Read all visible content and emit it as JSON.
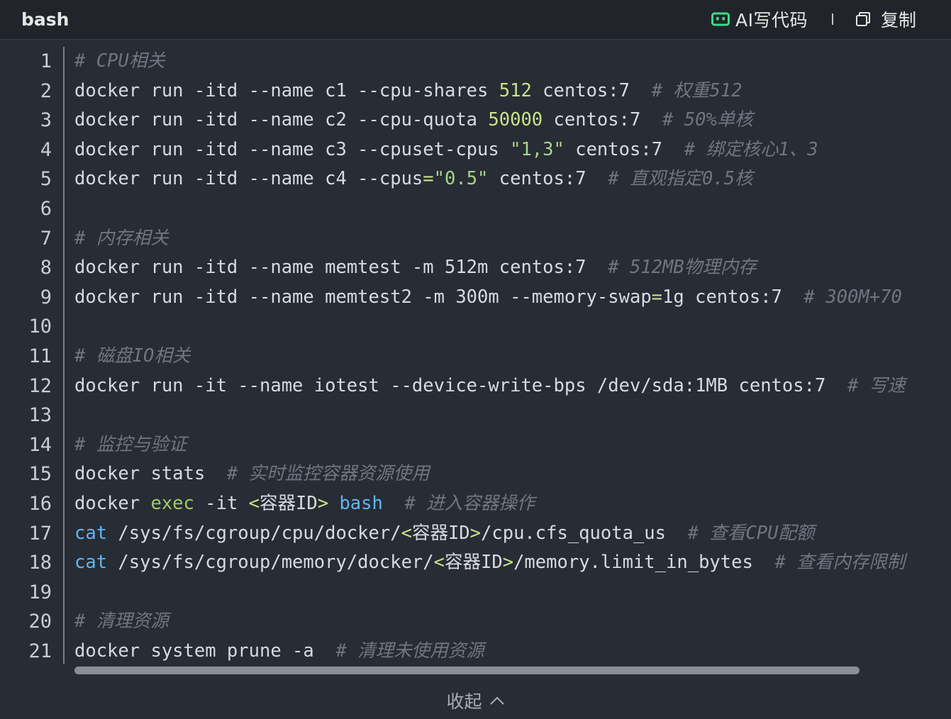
{
  "header": {
    "language": "bash",
    "ai_label": "AI写代码",
    "copy_label": "复制"
  },
  "footer": {
    "collapse_label": "收起"
  },
  "colors": {
    "background": "#282c34",
    "comment": "#6f7681",
    "number": "#c7e48a",
    "keyword": "#5fb7f0",
    "ai_icon": "#3ddc84"
  },
  "code": {
    "lines": [
      {
        "n": "1",
        "tokens": [
          {
            "t": "cmt",
            "v": "# CPU相关"
          }
        ]
      },
      {
        "n": "2",
        "tokens": [
          {
            "t": "plain",
            "v": "docker run -itd --name c1 --cpu-shares "
          },
          {
            "t": "num",
            "v": "512"
          },
          {
            "t": "plain",
            "v": " centos:7  "
          },
          {
            "t": "cmt",
            "v": "# 权重512"
          }
        ]
      },
      {
        "n": "3",
        "tokens": [
          {
            "t": "plain",
            "v": "docker run -itd --name c2 --cpu-quota "
          },
          {
            "t": "num",
            "v": "50000"
          },
          {
            "t": "plain",
            "v": " centos:7  "
          },
          {
            "t": "cmt",
            "v": "# 50%单核"
          }
        ]
      },
      {
        "n": "4",
        "tokens": [
          {
            "t": "plain",
            "v": "docker run -itd --name c3 --cpuset-cpus "
          },
          {
            "t": "str",
            "v": "\"1,3\""
          },
          {
            "t": "plain",
            "v": " centos:7  "
          },
          {
            "t": "cmt",
            "v": "# 绑定核心1、3"
          }
        ]
      },
      {
        "n": "5",
        "tokens": [
          {
            "t": "plain",
            "v": "docker run -itd --name c4 --cpus"
          },
          {
            "t": "op",
            "v": "="
          },
          {
            "t": "str",
            "v": "\"0.5\""
          },
          {
            "t": "plain",
            "v": " centos:7  "
          },
          {
            "t": "cmt",
            "v": "# 直观指定0.5核"
          }
        ]
      },
      {
        "n": "6",
        "tokens": []
      },
      {
        "n": "7",
        "tokens": [
          {
            "t": "cmt",
            "v": "# 内存相关"
          }
        ]
      },
      {
        "n": "8",
        "tokens": [
          {
            "t": "plain",
            "v": "docker run -itd --name memtest -m 512m centos:7  "
          },
          {
            "t": "cmt",
            "v": "# 512MB物理内存"
          }
        ]
      },
      {
        "n": "9",
        "tokens": [
          {
            "t": "plain",
            "v": "docker run -itd --name memtest2 -m 300m --memory-swap"
          },
          {
            "t": "op",
            "v": "="
          },
          {
            "t": "plain",
            "v": "1g centos:7  "
          },
          {
            "t": "cmt",
            "v": "# 300M+70"
          }
        ]
      },
      {
        "n": "10",
        "tokens": []
      },
      {
        "n": "11",
        "tokens": [
          {
            "t": "cmt",
            "v": "# 磁盘IO相关"
          }
        ]
      },
      {
        "n": "12",
        "tokens": [
          {
            "t": "plain",
            "v": "docker run -it --name iotest --device-write-bps /dev/sda:1MB centos:7  "
          },
          {
            "t": "cmt",
            "v": "# 写速"
          }
        ]
      },
      {
        "n": "13",
        "tokens": []
      },
      {
        "n": "14",
        "tokens": [
          {
            "t": "cmt",
            "v": "# 监控与验证"
          }
        ]
      },
      {
        "n": "15",
        "tokens": [
          {
            "t": "plain",
            "v": "docker stats  "
          },
          {
            "t": "cmt",
            "v": "# 实时监控容器资源使用"
          }
        ]
      },
      {
        "n": "16",
        "tokens": [
          {
            "t": "plain",
            "v": "docker "
          },
          {
            "t": "exec",
            "v": "exec"
          },
          {
            "t": "plain",
            "v": " -it "
          },
          {
            "t": "op",
            "v": "<"
          },
          {
            "t": "plain",
            "v": "容器ID"
          },
          {
            "t": "op",
            "v": ">"
          },
          {
            "t": "plain",
            "v": " "
          },
          {
            "t": "kw",
            "v": "bash"
          },
          {
            "t": "plain",
            "v": "  "
          },
          {
            "t": "cmt",
            "v": "# 进入容器操作"
          }
        ]
      },
      {
        "n": "17",
        "tokens": [
          {
            "t": "kw",
            "v": "cat"
          },
          {
            "t": "plain",
            "v": " /sys/fs/cgroup/cpu/docker/"
          },
          {
            "t": "op",
            "v": "<"
          },
          {
            "t": "plain",
            "v": "容器ID"
          },
          {
            "t": "op",
            "v": ">"
          },
          {
            "t": "plain",
            "v": "/cpu.cfs_quota_us  "
          },
          {
            "t": "cmt",
            "v": "# 查看CPU配额"
          }
        ]
      },
      {
        "n": "18",
        "tokens": [
          {
            "t": "kw",
            "v": "cat"
          },
          {
            "t": "plain",
            "v": " /sys/fs/cgroup/memory/docker/"
          },
          {
            "t": "op",
            "v": "<"
          },
          {
            "t": "plain",
            "v": "容器ID"
          },
          {
            "t": "op",
            "v": ">"
          },
          {
            "t": "plain",
            "v": "/memory.limit_in_bytes  "
          },
          {
            "t": "cmt",
            "v": "# 查看内存限制"
          }
        ]
      },
      {
        "n": "19",
        "tokens": []
      },
      {
        "n": "20",
        "tokens": [
          {
            "t": "cmt",
            "v": "# 清理资源"
          }
        ]
      },
      {
        "n": "21",
        "tokens": [
          {
            "t": "plain",
            "v": "docker system prune -a  "
          },
          {
            "t": "cmt",
            "v": "# 清理未使用资源"
          }
        ]
      }
    ]
  }
}
